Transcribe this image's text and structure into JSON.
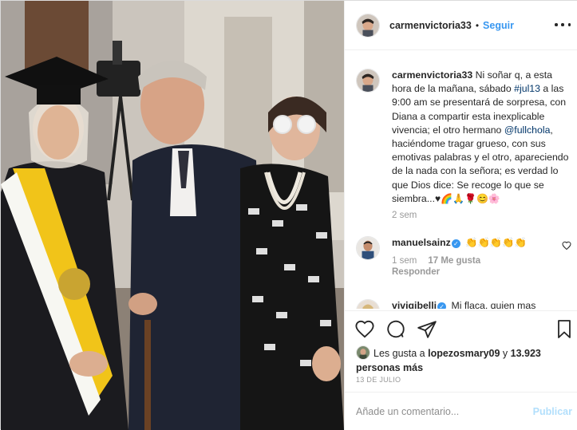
{
  "post": {
    "username": "carmenvictoria33",
    "separator": "•",
    "follow_label": "Seguir",
    "more_icon": "more-horizontal-icon"
  },
  "caption": {
    "username": "carmenvictoria33",
    "text_1": "Ni soñar q, a esta hora de la mañana, sábado ",
    "hashtag": "#jul13",
    "text_2": " a las 9:00 am se presentará de sorpresa, con Diana a compartir esta inexplicable vivencia; el otro hermano ",
    "mention": "@fullchola",
    "text_3": ", haciéndome tragar grueso, con sus emotivas palabras y el otro, apareciendo de la nada con la señora; es verdad lo que Dios dice: Se recoge lo que se siembra...",
    "emojis": "♥🌈🙏🌹😊🌸",
    "time": "2 sem"
  },
  "comments": [
    {
      "username": "manuelsainz",
      "verified": true,
      "text": "👏👏👏👏👏",
      "time": "1 sem",
      "likes": "17 Me gusta",
      "reply_label": "Responder"
    },
    {
      "username": "vivigibelli",
      "verified": true,
      "text": "Mi flaca, quien mas"
    }
  ],
  "actions": {
    "like_icon": "heart-icon",
    "comment_icon": "comment-icon",
    "share_icon": "share-icon",
    "save_icon": "bookmark-icon"
  },
  "likes": {
    "prefix": "Les gusta a ",
    "user": "lopezosmary09",
    "middle": " y ",
    "count": "13.923 personas más"
  },
  "date": "13 DE JULIO",
  "add_comment": {
    "placeholder": "Añade un comentario...",
    "publish_label": "Publicar"
  },
  "colors": {
    "accent": "#3897f0",
    "publish_disabled": "#b2dffc",
    "muted": "#999999",
    "border": "#efefef"
  }
}
